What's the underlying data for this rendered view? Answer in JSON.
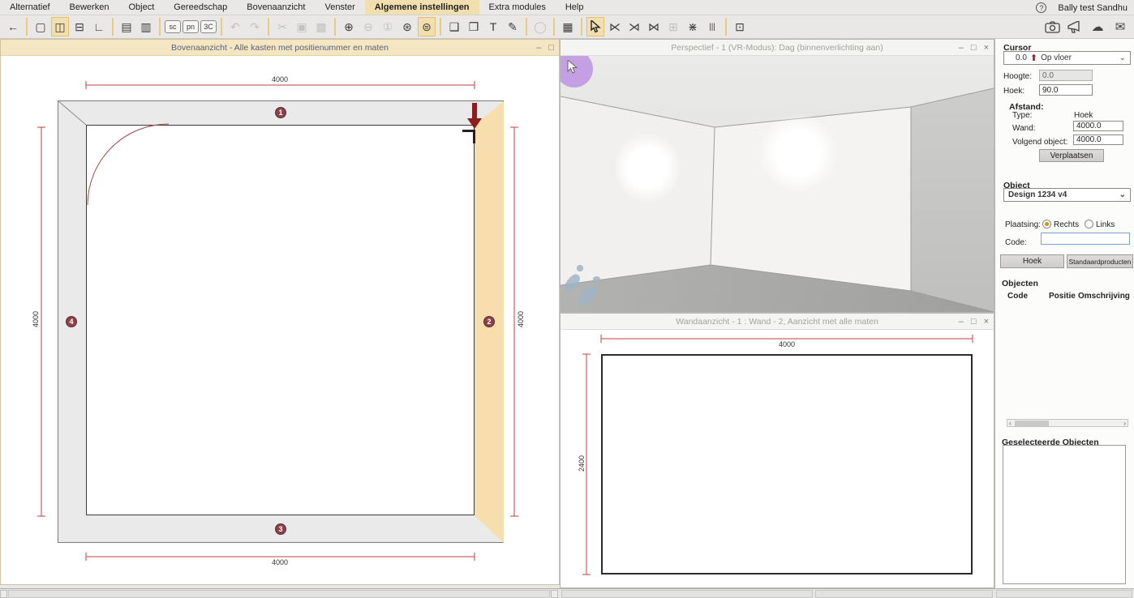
{
  "menu": {
    "items": [
      {
        "label": "Alternatief",
        "active": false
      },
      {
        "label": "Bewerken",
        "active": false
      },
      {
        "label": "Object",
        "active": false
      },
      {
        "label": "Gereedschap",
        "active": false
      },
      {
        "label": "Bovenaanzicht",
        "active": false
      },
      {
        "label": "Venster",
        "active": false
      },
      {
        "label": "Algemene instellingen",
        "active": true
      },
      {
        "label": "Extra modules",
        "active": false
      },
      {
        "label": "Help",
        "active": false
      }
    ],
    "help_glyph": "?",
    "user": "Bally test Sandhu"
  },
  "toolbar": {
    "buttons": [
      {
        "name": "back-button",
        "glyph": "←"
      },
      {
        "sep": true
      },
      {
        "name": "window-new-icon",
        "glyph": "▢"
      },
      {
        "name": "window-split-icon",
        "glyph": "◫",
        "state": "active"
      },
      {
        "name": "window-cascade-icon",
        "glyph": "⊟"
      },
      {
        "name": "window-corner-icon",
        "glyph": "∟"
      },
      {
        "sep": true
      },
      {
        "name": "save-button",
        "glyph": "▤"
      },
      {
        "name": "print-button",
        "glyph": "▥"
      },
      {
        "sep": true
      },
      {
        "name": "sc-button",
        "glyph": "sc",
        "chip": true
      },
      {
        "name": "pn-button",
        "glyph": "pn",
        "chip": true
      },
      {
        "name": "3c-button",
        "glyph": "3C",
        "chip": true
      },
      {
        "sep": true
      },
      {
        "name": "undo-button",
        "glyph": "↶",
        "state": "disabled"
      },
      {
        "name": "redo-button",
        "glyph": "↷",
        "state": "disabled"
      },
      {
        "sep": true
      },
      {
        "name": "cut-button",
        "glyph": "✂",
        "state": "disabled"
      },
      {
        "name": "copy-button",
        "glyph": "▣",
        "state": "disabled"
      },
      {
        "name": "paste-button",
        "glyph": "▩",
        "state": "disabled"
      },
      {
        "sep": true
      },
      {
        "name": "zoom-in-button",
        "glyph": "⊕"
      },
      {
        "name": "zoom-out-button",
        "glyph": "⊖",
        "state": "disabled"
      },
      {
        "name": "zoom-actual-button",
        "glyph": "①",
        "state": "disabled"
      },
      {
        "name": "zoom-selection-button",
        "glyph": "⊛"
      },
      {
        "name": "zoom-pan-button",
        "glyph": "⊜",
        "state": "active"
      },
      {
        "sep": true
      },
      {
        "name": "notes-button",
        "glyph": "❑"
      },
      {
        "name": "annotation-button",
        "glyph": "❒"
      },
      {
        "name": "text-tool-button",
        "glyph": "T"
      },
      {
        "name": "markup-button",
        "glyph": "✎"
      },
      {
        "sep": true
      },
      {
        "name": "arc-tool-button",
        "glyph": "◯",
        "state": "disabled"
      },
      {
        "sep": true
      },
      {
        "name": "calculator-button",
        "glyph": "▦"
      },
      {
        "sep": true
      },
      {
        "name": "select-cursor-button",
        "svg": "cursor",
        "state": "active"
      },
      {
        "name": "dimension-toggle-1-icon",
        "glyph": "⋉"
      },
      {
        "name": "dimension-toggle-2-icon",
        "glyph": "⋊"
      },
      {
        "name": "dimension-toggle-3-icon",
        "glyph": "⋈"
      },
      {
        "name": "grid-button",
        "glyph": "⊞",
        "state": "disabled"
      },
      {
        "name": "dimension-toggle-4-icon",
        "glyph": "⋇"
      },
      {
        "name": "section-lines-button",
        "glyph": "|||"
      },
      {
        "sep": true
      },
      {
        "name": "stamp-button",
        "glyph": "⊡"
      }
    ],
    "right_icons": [
      {
        "name": "gallery-icon",
        "svg": "camera"
      },
      {
        "name": "announce-icon",
        "svg": "megaphone"
      },
      {
        "name": "cloud-icon",
        "glyph": "☁"
      },
      {
        "name": "mail-icon",
        "glyph": "✉"
      }
    ]
  },
  "windows": {
    "plan": {
      "title": "Bovenaanzicht - Alle kasten met positienummer en maten",
      "minimize": "–",
      "maximize": "□",
      "dims": {
        "top": "4000",
        "bottom": "4000",
        "left": "4000",
        "right": "4000"
      },
      "walls": [
        {
          "number": "1"
        },
        {
          "number": "2"
        },
        {
          "number": "3"
        },
        {
          "number": "4"
        }
      ]
    },
    "perspective": {
      "title": "Perspectief - 1 (VR-Modus): Dag (binnenverlichting aan)",
      "minimize": "–",
      "maximize": "□",
      "close": "×"
    },
    "wall_view": {
      "title": "Wandaanzicht - 1 : Wand - 2, Aanzicht met alle maten",
      "minimize": "–",
      "maximize": "□",
      "close": "×",
      "dims": {
        "width": "4000",
        "height": "2400"
      }
    }
  },
  "sidebar": {
    "cursor": {
      "label": "Cursor",
      "dropdown_value": "0.0",
      "dropdown_mode": "Op vloer",
      "hoogte_label": "Hoogte:",
      "hoogte_value": "0.0",
      "hoek_label": "Hoek:",
      "hoek_value": "90.0",
      "afstand_label": "Afstand:",
      "type_label": "Type:",
      "type_value": "Hoek",
      "wand_label": "Wand:",
      "wand_value": "4000.0",
      "volgend_label": "Volgend object:",
      "volgend_value": "4000.0",
      "verplaatsen_button": "Verplaatsen"
    },
    "object": {
      "label": "Object",
      "dropdown_value": "Design 1234 v4",
      "plaatsing_label": "Plaatsing:",
      "rechts_label": "Rechts",
      "links_label": "Links",
      "code_label": "Code:",
      "code_value": "",
      "hoek_button": "Hoek",
      "standaard_button": "Standaardproducten",
      "objecten_label": "Objecten",
      "columns": {
        "c1": "Code",
        "c2": "Positie",
        "c3": "Omschrijving"
      }
    },
    "selected": {
      "label": "Geselecteerde Objecten"
    }
  },
  "colors": {
    "accent_tan": "#f1dfb0",
    "selected_wall": "#f6dfad",
    "dimension_red": "#c04040",
    "wall_marker": "#8c4149",
    "arrow_red": "#8e1d1d",
    "cursor_halo": "#ba8ae2"
  }
}
